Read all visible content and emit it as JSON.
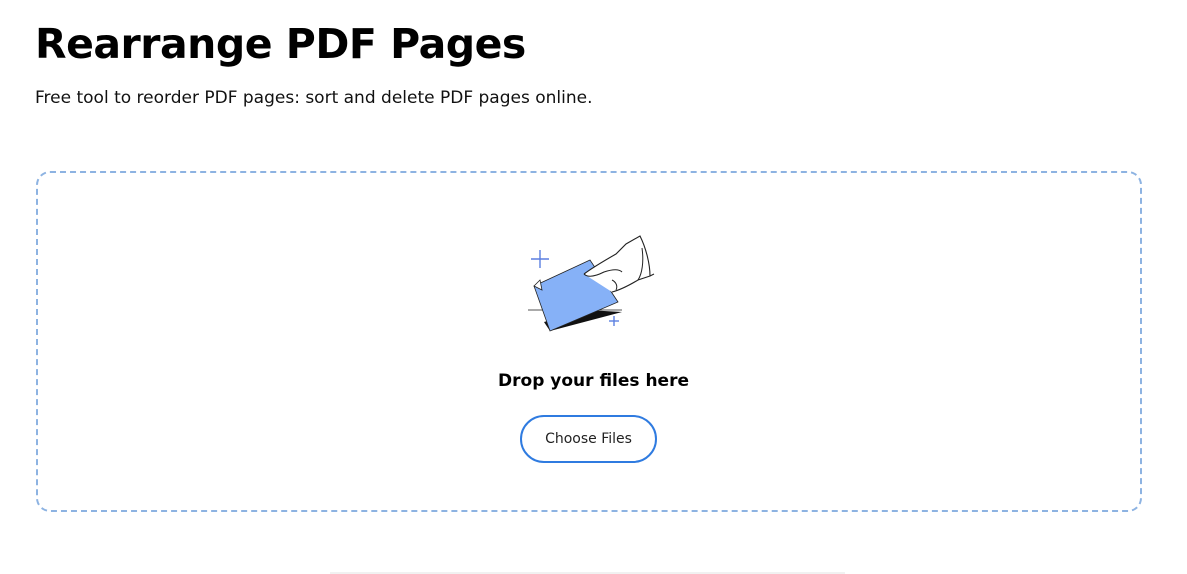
{
  "header": {
    "title": "Rearrange PDF Pages",
    "subtitle": "Free tool to reorder PDF pages: sort and delete PDF pages online."
  },
  "dropzone": {
    "label": "Drop your files here",
    "button_label": "Choose Files",
    "illustration_icon": "hand-dropping-file-icon",
    "accent_color": "#86b1f7",
    "border_color": "#8db3e2",
    "button_border_color": "#2f7be0"
  }
}
